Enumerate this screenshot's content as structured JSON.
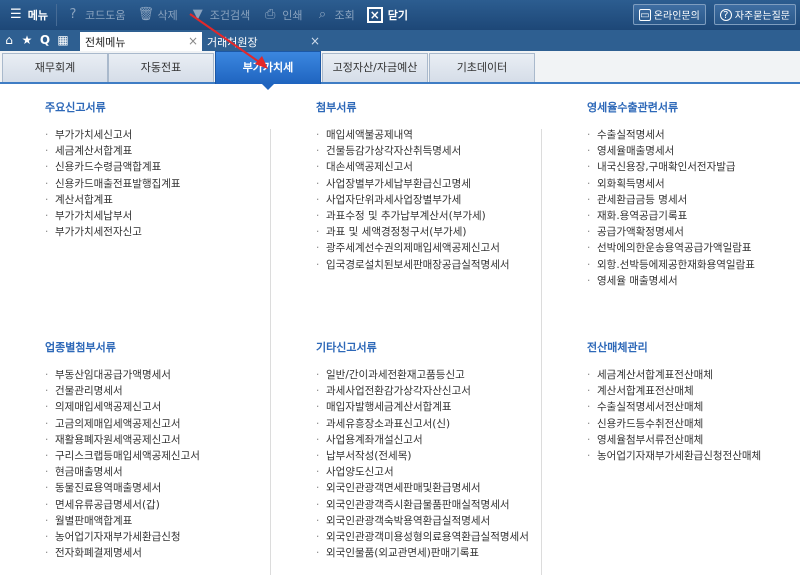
{
  "toolbar": {
    "menu_label": "메뉴",
    "items": [
      {
        "label": "코드도움",
        "icon": "question-icon"
      },
      {
        "label": "삭제",
        "icon": "trash-icon"
      },
      {
        "label": "조건검색",
        "icon": "filter-icon"
      },
      {
        "label": "인쇄",
        "icon": "printer-icon"
      },
      {
        "label": "조회",
        "icon": "search-icon"
      }
    ],
    "close_label": "닫기",
    "online_inquiry": "온라인문의",
    "faq": "자주묻는질문"
  },
  "window_tabs": [
    {
      "label": "전체메뉴",
      "active": true
    },
    {
      "label": "거래처원장",
      "active": false
    }
  ],
  "category_tabs": [
    "재무회계",
    "자동전표",
    "부가가치세",
    "고정자산/자금예산",
    "기초데이터"
  ],
  "sections": [
    {
      "title": "주요신고서류",
      "items": [
        "부가가치세신고서",
        "세금계산서합계표",
        "신용카드수령금액합계표",
        "신용카드매출전표발행집계표",
        "계산서합계표",
        "부가가치세납부서",
        "부가가치세전자신고"
      ]
    },
    {
      "title": "첨부서류",
      "items": [
        "매입세액불공제내역",
        "건물등감가상각자산취득명세서",
        "대손세액공제신고서",
        "사업장별부가세납부환급신고명세",
        "사업자단위과세사업장별부가세",
        "과표수정 및 추가납부계산서(부가세)",
        "과표 및 세액경정청구서(부가세)",
        "광주세계선수권의제매입세액공제신고서",
        "입국경로설치된보세판매장공급실적명세서"
      ]
    },
    {
      "title": "영세율수출관련서류",
      "items": [
        "수출실적명세서",
        "영세율매출명세서",
        "내국신용장,구매확인서전자발급",
        "외화획득명세서",
        "관세환급금등 명세서",
        "재화.용역공급기록표",
        "공급가액확정명세서",
        "선박에의한운송용역공급가액일람표",
        "외항.선박등에제공한재화용역일람표",
        "영세율 매출명세서"
      ]
    },
    {
      "title": "업종별첨부서류",
      "items": [
        "부동산임대공급가액명세서",
        "건물관리명세서",
        "의제매입세액공제신고서",
        "고금의제매입세액공제신고서",
        "재활용폐자원세액공제신고서",
        "구리스크랩등매입세액공제신고서",
        "현금매출명세서",
        "동물진료용역매출명세서",
        "면세유류공급명세서(갑)",
        "월별판매액합계표",
        "농어업기자재부가세환급신청",
        "전자화폐결제명세서"
      ]
    },
    {
      "title": "기타신고서류",
      "items": [
        "일반/간이과세전환재고품등신고",
        "과세사업전환감가상각자산신고서",
        "매입자발행세금계산서합계표",
        "과세유흥장소과표신고서(신)",
        "사업용계좌개설신고서",
        "납부서작성(전세목)",
        "사업양도신고서",
        "외국인관광객면세판매및환급명세서",
        "외국인관광객즉시환급물품판매실적명세서",
        "외국인관광객숙박용역환급실적명세서",
        "외국인관광객미용성형의료용역환급실적명세서",
        "외국인물품(외교관면세)판매기록표"
      ]
    },
    {
      "title": "전산매체관리",
      "items": [
        "세금계산서합계표전산매체",
        "계산서합계표전산매체",
        "수출실적명세서전산매체",
        "신용카드등수취전산매체",
        "영세율첨부서류전산매체",
        "농어업기자재부가세환급신청전산매체"
      ]
    }
  ],
  "colors": {
    "toolbar_bg": "#1d4777",
    "active_tab": "#1f64bf",
    "section_title": "#2d68b8",
    "arrow": "#e3282a"
  }
}
